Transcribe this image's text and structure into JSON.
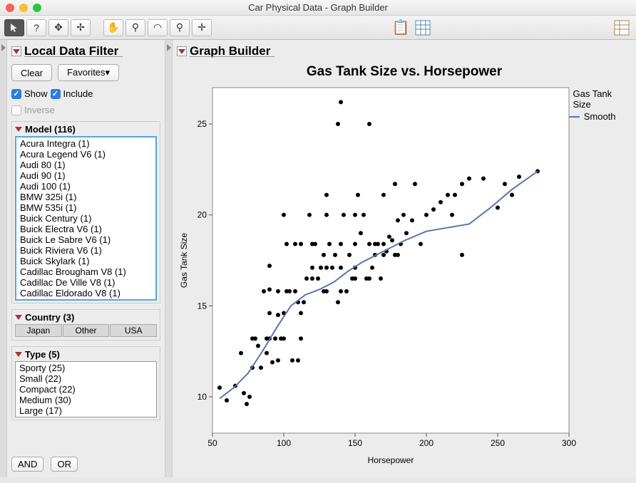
{
  "window": {
    "title": "Car Physical Data - Graph Builder"
  },
  "sidebar": {
    "title": "Local Data Filter",
    "clear": "Clear",
    "favorites": "Favorites▾",
    "show_label": "Show",
    "include_label": "Include",
    "inverse_label": "Inverse",
    "model_title": "Model (116)",
    "model_items": [
      "Acura Integra (1)",
      "Acura Legend V6 (1)",
      "Audi 80 (1)",
      "Audi 90 (1)",
      "Audi 100 (1)",
      "BMW 325i (1)",
      "BMW 535i (1)",
      "Buick Century (1)",
      "Buick Electra V6 (1)",
      "Buick Le Sabre V6 (1)",
      "Buick Riviera V6 (1)",
      "Buick Skylark (1)",
      "Cadillac Brougham V8 (1)",
      "Cadillac De Ville V8 (1)",
      "Cadillac Eldorado V8 (1)"
    ],
    "country_title": "Country (3)",
    "country_items": [
      "Japan",
      "Other",
      "USA"
    ],
    "type_title": "Type (5)",
    "type_items": [
      "Sporty (25)",
      "Small (22)",
      "Compact (22)",
      "Medium (30)",
      "Large (17)"
    ],
    "and": "AND",
    "or": "OR"
  },
  "builder": {
    "title": "Graph Builder"
  },
  "legend": {
    "points": "Gas Tank Size",
    "smooth": "Smooth"
  },
  "chart_data": {
    "type": "scatter",
    "title": "Gas Tank Size vs. Horsepower",
    "xlabel": "Horsepower",
    "ylabel": "Gas Tank Size",
    "xlim": [
      50,
      300
    ],
    "ylim": [
      8,
      27
    ],
    "xticks": [
      50,
      100,
      150,
      200,
      250,
      300
    ],
    "yticks": [
      10,
      15,
      20,
      25
    ],
    "series": [
      {
        "name": "Gas Tank Size",
        "type": "scatter",
        "x": [
          55,
          60,
          66,
          70,
          72,
          74,
          76,
          78,
          78,
          80,
          82,
          84,
          86,
          88,
          88,
          90,
          90,
          90,
          90,
          92,
          94,
          96,
          96,
          96,
          98,
          100,
          100,
          100,
          102,
          102,
          104,
          106,
          108,
          108,
          110,
          110,
          112,
          112,
          112,
          114,
          116,
          118,
          120,
          120,
          120,
          122,
          124,
          126,
          128,
          128,
          130,
          130,
          130,
          130,
          132,
          134,
          136,
          138,
          138,
          140,
          140,
          140,
          140,
          142,
          144,
          146,
          148,
          150,
          150,
          150,
          150,
          152,
          154,
          156,
          158,
          160,
          160,
          160,
          162,
          164,
          164,
          166,
          168,
          170,
          170,
          170,
          172,
          174,
          176,
          178,
          178,
          180,
          180,
          182,
          184,
          186,
          190,
          192,
          196,
          200,
          205,
          210,
          215,
          218,
          220,
          225,
          225,
          230,
          240,
          250,
          255,
          260,
          265,
          278
        ],
        "y": [
          10.5,
          9.8,
          10.6,
          12.4,
          10.2,
          9.6,
          10,
          11.6,
          13.2,
          13.2,
          12.8,
          11.6,
          15.8,
          12.4,
          13.2,
          13.2,
          14.6,
          15.9,
          17.2,
          11.9,
          13.2,
          12.0,
          14.5,
          15.8,
          13.2,
          13.2,
          14.6,
          20.0,
          15.8,
          18.4,
          15.8,
          12.0,
          15.8,
          18.4,
          12.0,
          15.2,
          13.2,
          14.6,
          18.4,
          15.2,
          16.5,
          20.0,
          16.5,
          17.1,
          18.4,
          18.4,
          16.5,
          17.1,
          15.8,
          17.8,
          15.8,
          17.1,
          20.0,
          21.1,
          18.4,
          17.1,
          17.8,
          15.2,
          25.0,
          15.8,
          17.1,
          18.4,
          26.2,
          20.0,
          15.8,
          17.8,
          16.5,
          16.5,
          17.1,
          18.4,
          20.0,
          21.1,
          19.0,
          20.0,
          16.5,
          18.4,
          16.5,
          25.0,
          17.1,
          17.8,
          18.4,
          18.4,
          16.5,
          17.8,
          21.1,
          18.4,
          18.0,
          18.8,
          18.6,
          17.8,
          21.7,
          19.7,
          17.8,
          18.4,
          20.0,
          19.0,
          19.7,
          21.7,
          18.4,
          20.0,
          20.3,
          20.7,
          21.1,
          20.0,
          21.1,
          17.8,
          21.7,
          22.0,
          22.0,
          20.4,
          21.7,
          21.1,
          22.1,
          22.4
        ]
      },
      {
        "name": "Smooth",
        "type": "line",
        "x": [
          55,
          65,
          75,
          85,
          95,
          105,
          115,
          125,
          135,
          145,
          155,
          165,
          175,
          185,
          200,
          215,
          230,
          245,
          260,
          278
        ],
        "y": [
          9.9,
          10.5,
          11.3,
          12.5,
          13.8,
          15.0,
          15.6,
          15.9,
          16.3,
          16.9,
          17.4,
          17.8,
          18.2,
          18.6,
          19.1,
          19.3,
          19.5,
          20.4,
          21.4,
          22.4
        ]
      }
    ]
  }
}
